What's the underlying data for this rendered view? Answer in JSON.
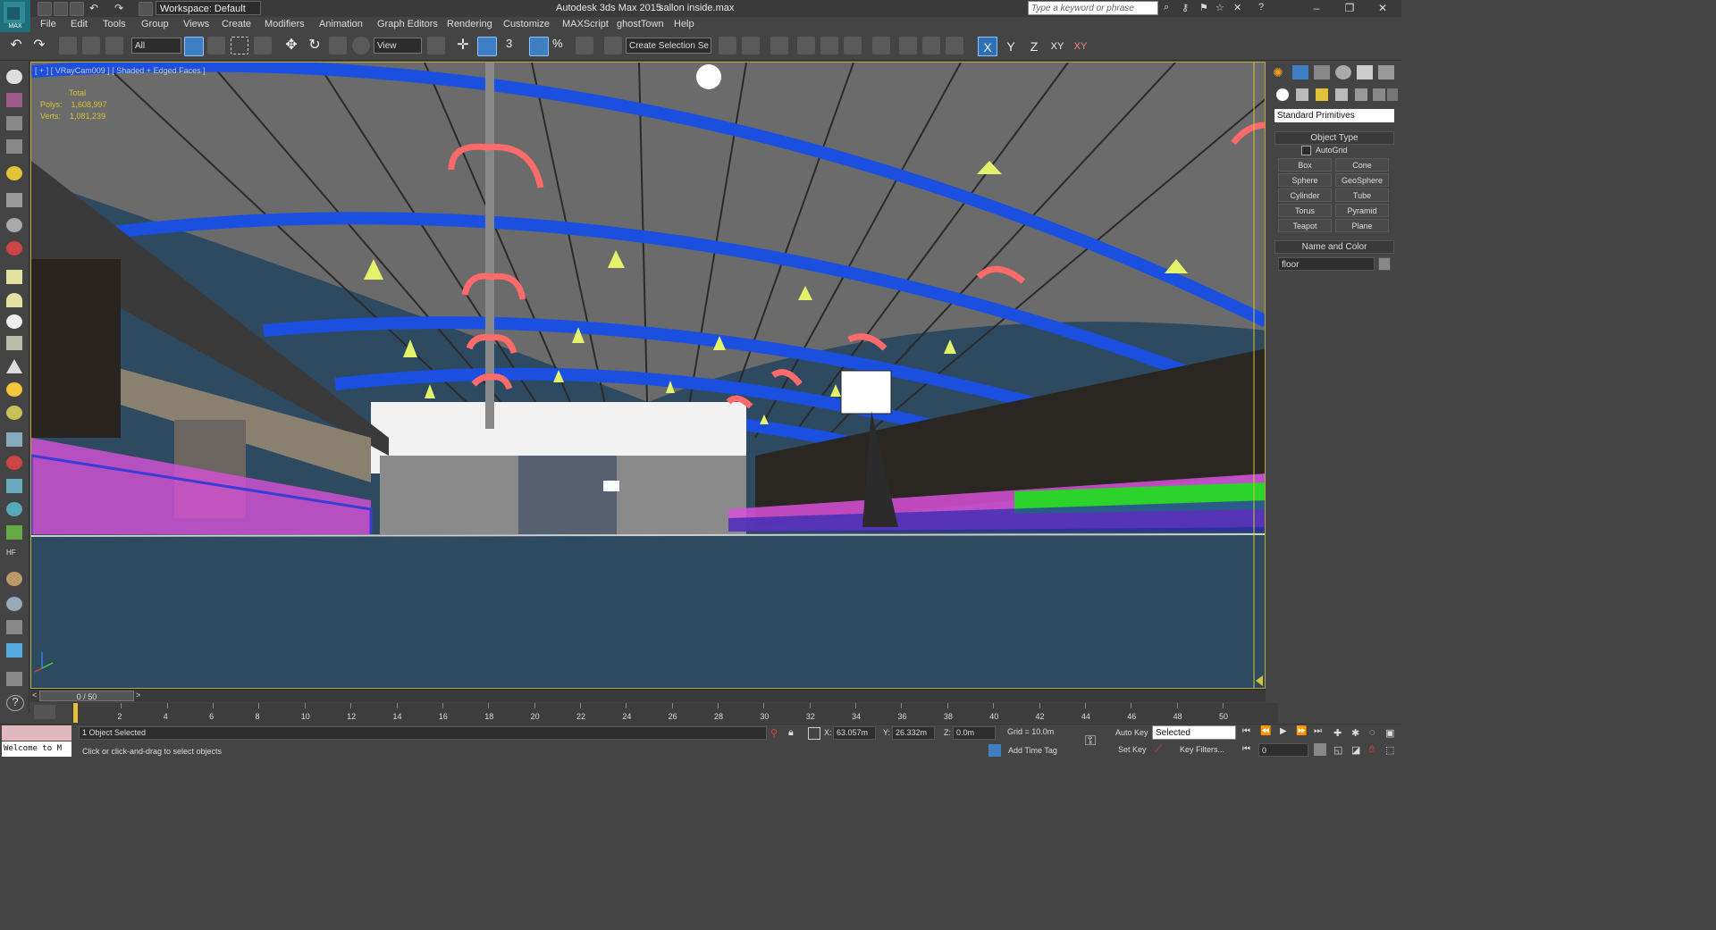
{
  "app": {
    "title": "Autodesk 3ds Max  2015",
    "file": "sallon inside.max",
    "workspace": "Workspace: Default",
    "search_placeholder": "Type a keyword or phrase",
    "logo_text": "MAX"
  },
  "menu": [
    "File",
    "Edit",
    "Tools",
    "Group",
    "Views",
    "Create",
    "Modifiers",
    "Animation",
    "Graph Editors",
    "Rendering",
    "Customize",
    "MAXScript",
    "ghostTown",
    "Help"
  ],
  "toolbar": {
    "selection_filter": "All",
    "reference_coord": "View",
    "named_selection": "Create Selection Se",
    "axis_labels": [
      "X",
      "Y",
      "Z",
      "XY",
      "XY"
    ],
    "snap_label": "3",
    "percent_label": "%"
  },
  "viewport": {
    "label": "[ + ] [ VRayCam009 ] [ Shaded + Edged Faces ]",
    "stats_header": "Total",
    "polys_label": "Polys:",
    "polys_value": "1,608,997",
    "verts_label": "Verts:",
    "verts_value": "1,081,239"
  },
  "command_panel": {
    "category": "Standard Primitives",
    "object_type_header": "Object Type",
    "autogrid_label": "AutoGrid",
    "primitives": [
      "Box",
      "Cone",
      "Sphere",
      "GeoSphere",
      "Cylinder",
      "Tube",
      "Torus",
      "Pyramid",
      "Teapot",
      "Plane"
    ],
    "name_color_header": "Name and Color",
    "object_name": "floor",
    "object_color": "#888888"
  },
  "timeline": {
    "frame_display": "0 / 50",
    "ticks": [
      "0",
      "2",
      "4",
      "6",
      "8",
      "10",
      "12",
      "14",
      "16",
      "18",
      "20",
      "22",
      "24",
      "26",
      "28",
      "30",
      "32",
      "34",
      "36",
      "38",
      "40",
      "42",
      "44",
      "46",
      "48",
      "50"
    ]
  },
  "status": {
    "maxscript_text": "Welcome to M",
    "selection_info": "1 Object Selected",
    "prompt": "Click or click-and-drag to select objects",
    "x_label": "X:",
    "x_value": "63.057m",
    "y_label": "Y:",
    "y_value": "26.332m",
    "z_label": "Z:",
    "z_value": "0.0m",
    "grid": "Grid = 10.0m",
    "add_time_tag": "Add Time Tag",
    "auto_key": "Auto Key",
    "auto_key_mode": "Selected",
    "set_key": "Set Key",
    "key_filters": "Key Filters...",
    "current_frame": "0"
  },
  "colors": {
    "viewport_bg": "#2e4a61",
    "ceiling_grey": "#6b6b6b",
    "truss_blue": "#1a4fe0",
    "lamp_yellow": "#e3f26a",
    "duct_red": "#ff6a6a",
    "seat_magenta": "#d850d8",
    "seat_green": "#2bd32b",
    "railing_blue": "#3b3bd6",
    "active_border": "#bba83a"
  }
}
